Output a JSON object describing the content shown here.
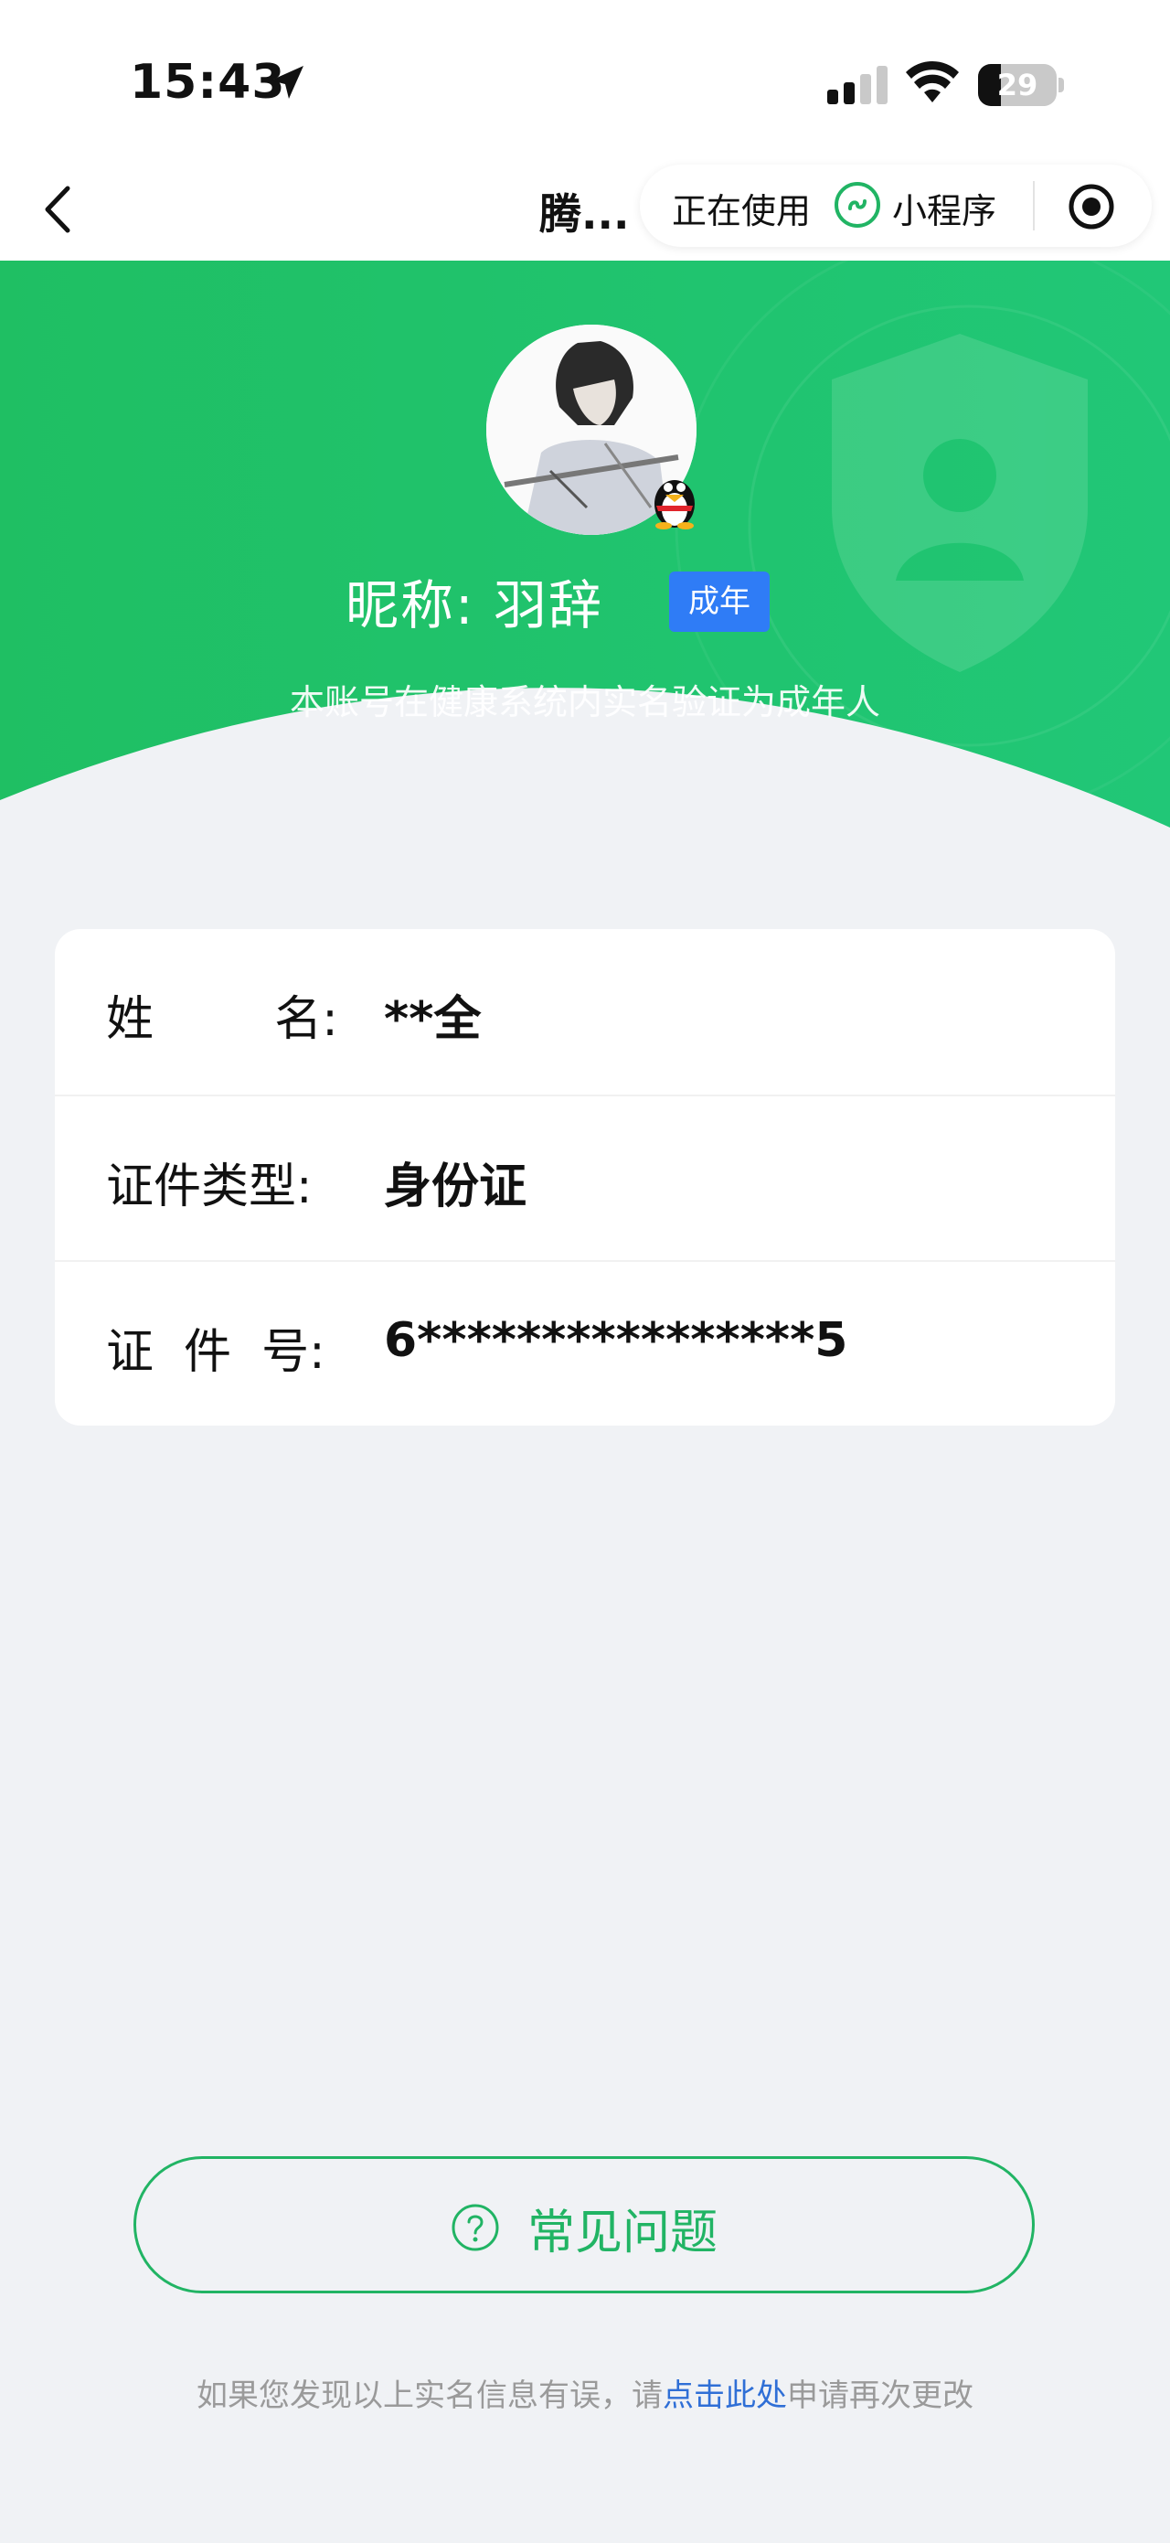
{
  "status_bar": {
    "time": "15:43",
    "battery": "29",
    "battery_level": 0.29
  },
  "navbar": {
    "title": "腾...",
    "capsule_in_use": "正在使用",
    "capsule_miniprogram": "小程序"
  },
  "profile": {
    "nickname_label": "昵称:",
    "nickname": "羽辞",
    "badge": "成年",
    "verify_text": "本账号在健康系统内实名验证为成年人"
  },
  "info": [
    {
      "label": "姓        名:",
      "value": "**全"
    },
    {
      "label": "证件类型:",
      "value": "身份证"
    },
    {
      "label": "证  件  号:",
      "value": "6****************5"
    }
  ],
  "faq": {
    "label": "常见问题"
  },
  "footer": {
    "prefix": "如果您发现以上实名信息有误，请",
    "link": "点击此处",
    "suffix": "申请再次更改"
  },
  "colors": {
    "green": "#21b464",
    "badge_blue": "#2f7cf6",
    "link_blue": "#2f6fd6",
    "page_bg": "#f0f2f5"
  }
}
